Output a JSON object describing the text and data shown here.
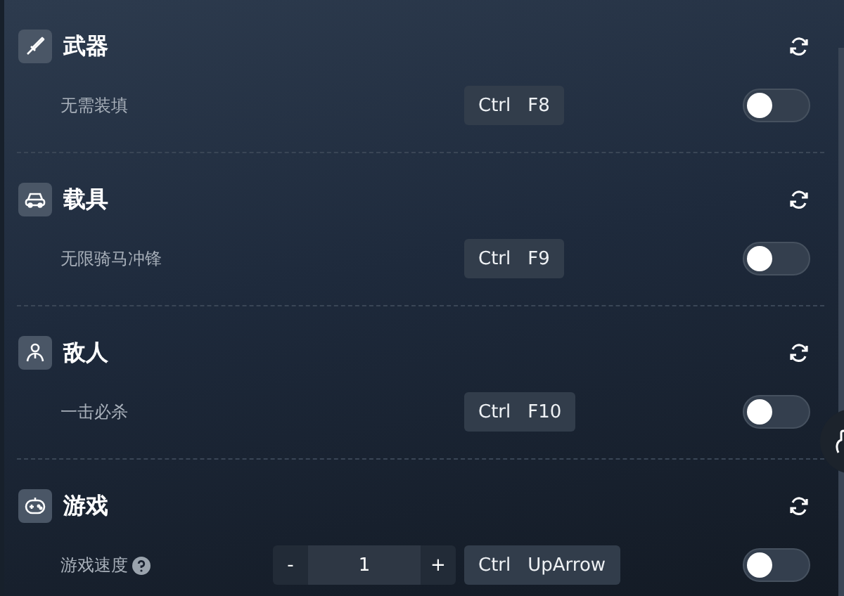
{
  "sections": [
    {
      "title": "武器",
      "items": [
        {
          "kind": "toggle",
          "label": "无需装填",
          "keys": [
            "Ctrl",
            "F8"
          ],
          "on": false
        }
      ]
    },
    {
      "title": "载具",
      "items": [
        {
          "kind": "toggle",
          "label": "无限骑马冲锋",
          "keys": [
            "Ctrl",
            "F9"
          ],
          "on": false
        }
      ]
    },
    {
      "title": "敌人",
      "items": [
        {
          "kind": "toggle",
          "label": "一击必杀",
          "keys": [
            "Ctrl",
            "F10"
          ],
          "on": false
        }
      ]
    },
    {
      "title": "游戏",
      "items": [
        {
          "kind": "stepper",
          "label": "游戏速度",
          "minus": "-",
          "value": "1",
          "plus": "+",
          "keys": [
            "Ctrl",
            "UpArrow"
          ],
          "on": false
        }
      ]
    }
  ]
}
